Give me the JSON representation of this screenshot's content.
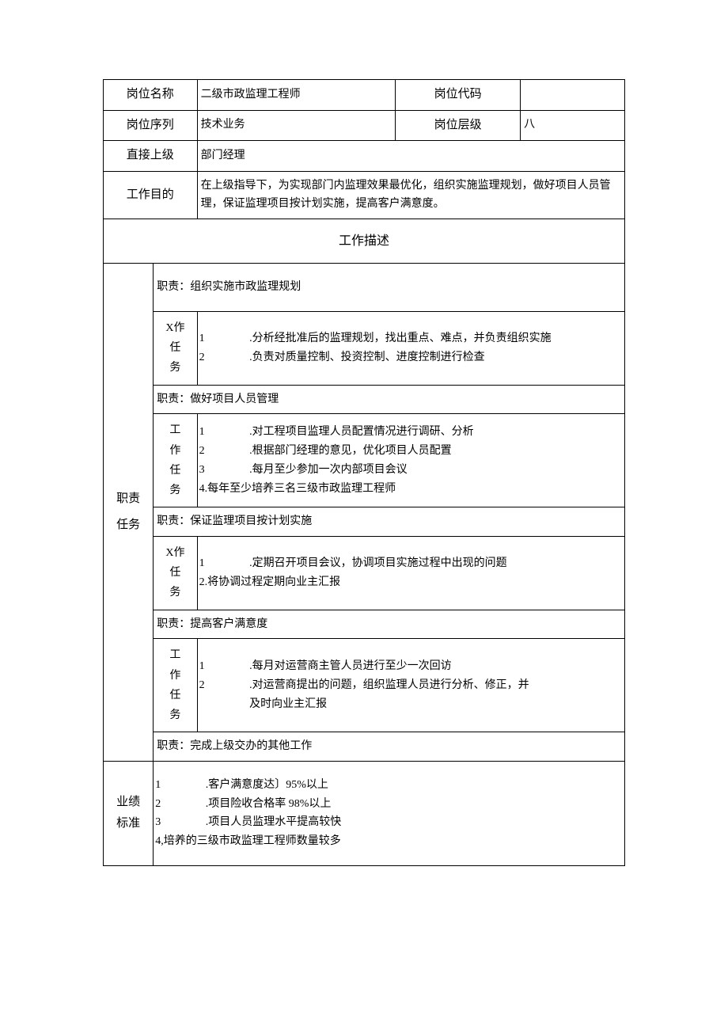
{
  "header": {
    "posNameLabel": "岗位名称",
    "posName": "二级市政监理工程师",
    "posCodeLabel": "岗位代码",
    "posCode": "",
    "posSeqLabel": "岗位序列",
    "posSeq": "技术业务",
    "posLevelLabel": "岗位层级",
    "posLevel": "八",
    "supLabel": "直接上级",
    "sup": "部门经理",
    "purposeLabel": "工作目的",
    "purpose": "在上级指导下，为实现部门内监理效果最优化，组织实施监理规划，做好项目人员管理，保证监理项目按计划实施，提高客户满意度。"
  },
  "descTitle": "工作描述",
  "sideDuty": "职责\n任务",
  "duty1": {
    "title": "职责：组织实施市政监理规划",
    "label": "X作\n任\n务",
    "nums": "1\n2",
    "txts": ".分析经批准后的监理规划，找出重点、难点，并负责组织实施\n.负责对质量控制、投资控制、进度控制进行检查"
  },
  "duty2": {
    "title": "职责：做好项目人员管理",
    "label": "工\n作\n任\n务",
    "nums": "1\n2\n3",
    "txts": ".对工程项目监理人员配置情况进行调研、分析\n.根据部门经理的意见，优化项目人员配置\n.每月至少参加一次内部项目会议",
    "line4": "4.每年至少培养三名三级市政监理工程师"
  },
  "duty3": {
    "title": "职责：保证监理项目按计划实施",
    "label": "X作\n任\n务",
    "nums": "1",
    "txt1": ".定期召开项目会议，协调项目实施过程中出现的问题",
    "line2": "2.将协调过程定期向业主汇报"
  },
  "duty4": {
    "title": "职责：提高客户满意度",
    "label": "工\n作\n任\n务",
    "nums": "1\n2",
    "txts": ".每月对运营商主管人员进行至少一次回访\n.对运营商提出的问题，组织监理人员进行分析、修正，并及时向业主汇报"
  },
  "duty5": {
    "title": "职责：完成上级交办的其他工作"
  },
  "perf": {
    "label": "业绩\n标准",
    "nums": "1\n2\n3",
    "txts": ".客户满意度达〕95%以上\n.项目险收合格率 98%以上\n.项目人员监理水平提高较快",
    "line4": "4,培养的三级市政监理工程师数量较多"
  }
}
